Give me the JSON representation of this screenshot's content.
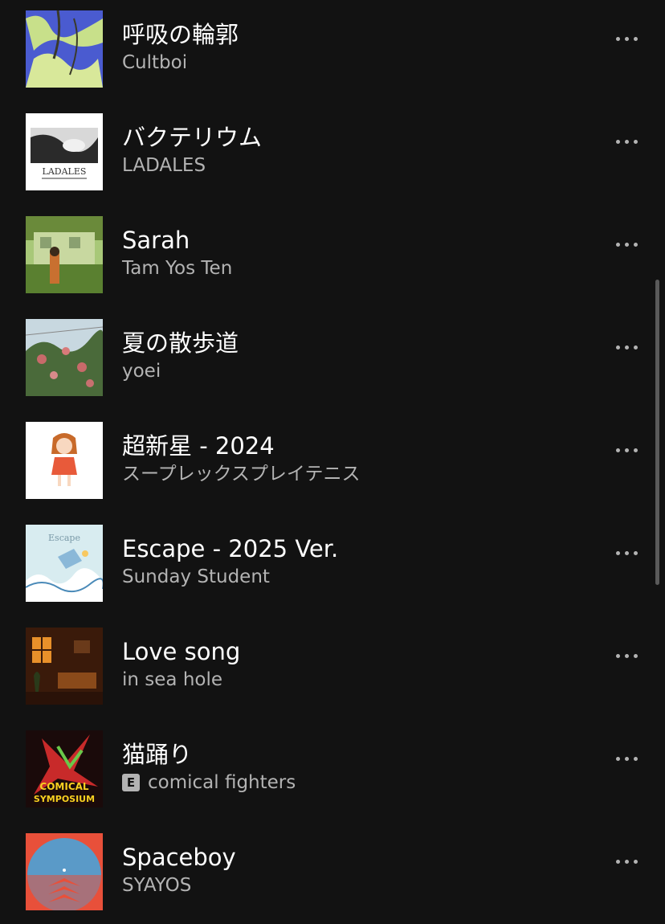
{
  "tracks": [
    {
      "title": "呼吸の輪郭",
      "artist": "Cultboi",
      "explicit": false,
      "cover_icon": "album-cover-cultboi"
    },
    {
      "title": "バクテリウム",
      "artist": "LADALES",
      "explicit": false,
      "cover_icon": "album-cover-ladales",
      "cover_text": "LADALES"
    },
    {
      "title": "Sarah",
      "artist": "Tam Yos Ten",
      "explicit": false,
      "cover_icon": "album-cover-sarah"
    },
    {
      "title": "夏の散歩道",
      "artist": "yoei",
      "explicit": false,
      "cover_icon": "album-cover-yoei"
    },
    {
      "title": "超新星 - 2024",
      "artist": "スープレックスプレイテニス",
      "explicit": false,
      "cover_icon": "album-cover-supernova"
    },
    {
      "title": "Escape - 2025 Ver.",
      "artist": "Sunday Student",
      "explicit": false,
      "cover_icon": "album-cover-escape",
      "cover_text": "Escape"
    },
    {
      "title": "Love song",
      "artist": "in sea hole",
      "explicit": false,
      "cover_icon": "album-cover-love-song"
    },
    {
      "title": "猫踊り",
      "artist": "comical fighters",
      "explicit": true,
      "explicit_label": "E",
      "cover_icon": "album-cover-comical",
      "cover_text": [
        "COMICAL",
        "SYMPOSIUM"
      ]
    },
    {
      "title": "Spaceboy",
      "artist": "SYAYOS",
      "explicit": false,
      "cover_icon": "album-cover-spaceboy"
    }
  ],
  "more_icon": "ellipsis-icon",
  "colors": {
    "background": "#121212",
    "title": "#ffffff",
    "subtitle": "#b3b3b3",
    "scrollbar": "#5a5a5a"
  }
}
